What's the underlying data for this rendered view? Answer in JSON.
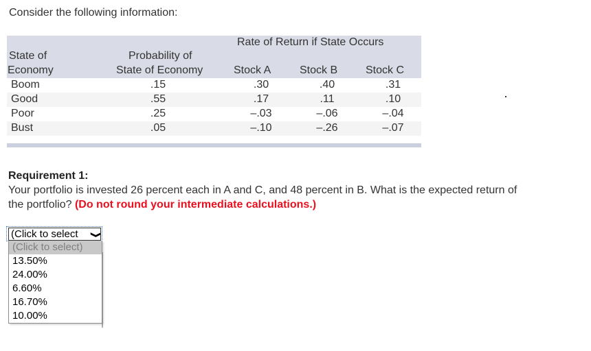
{
  "intro": "Consider the following information:",
  "table": {
    "group_header": "Rate of Return if State Occurs",
    "headers": {
      "state_line1": "State of",
      "state_line2": "Economy",
      "prob_line1": "Probability of",
      "prob_line2": "State of Economy",
      "stock_a": "Stock A",
      "stock_b": "Stock B",
      "stock_c": "Stock C"
    },
    "rows": [
      {
        "state": "Boom",
        "prob": ".15",
        "a": ".30",
        "b": ".40",
        "c": ".31"
      },
      {
        "state": "Good",
        "prob": ".55",
        "a": ".17",
        "b": ".11",
        "c": ".10"
      },
      {
        "state": "Poor",
        "prob": ".25",
        "a": "–.03",
        "b": "–.06",
        "c": "–.04"
      },
      {
        "state": "Bust",
        "prob": ".05",
        "a": "–.10",
        "b": "–.26",
        "c": "–.07"
      }
    ]
  },
  "requirement": {
    "title": "Requirement 1:",
    "text": "Your portfolio is invested 26 percent each in A and C, and 48 percent in B. What is the expected return of the portfolio? ",
    "note": "(Do not round your intermediate calculations.)"
  },
  "answer_select": {
    "selected": "(Click to select",
    "options": [
      "(Click to select)",
      "13.50%",
      "24.00%",
      "6.60%",
      "16.70%",
      "10.00%"
    ]
  }
}
